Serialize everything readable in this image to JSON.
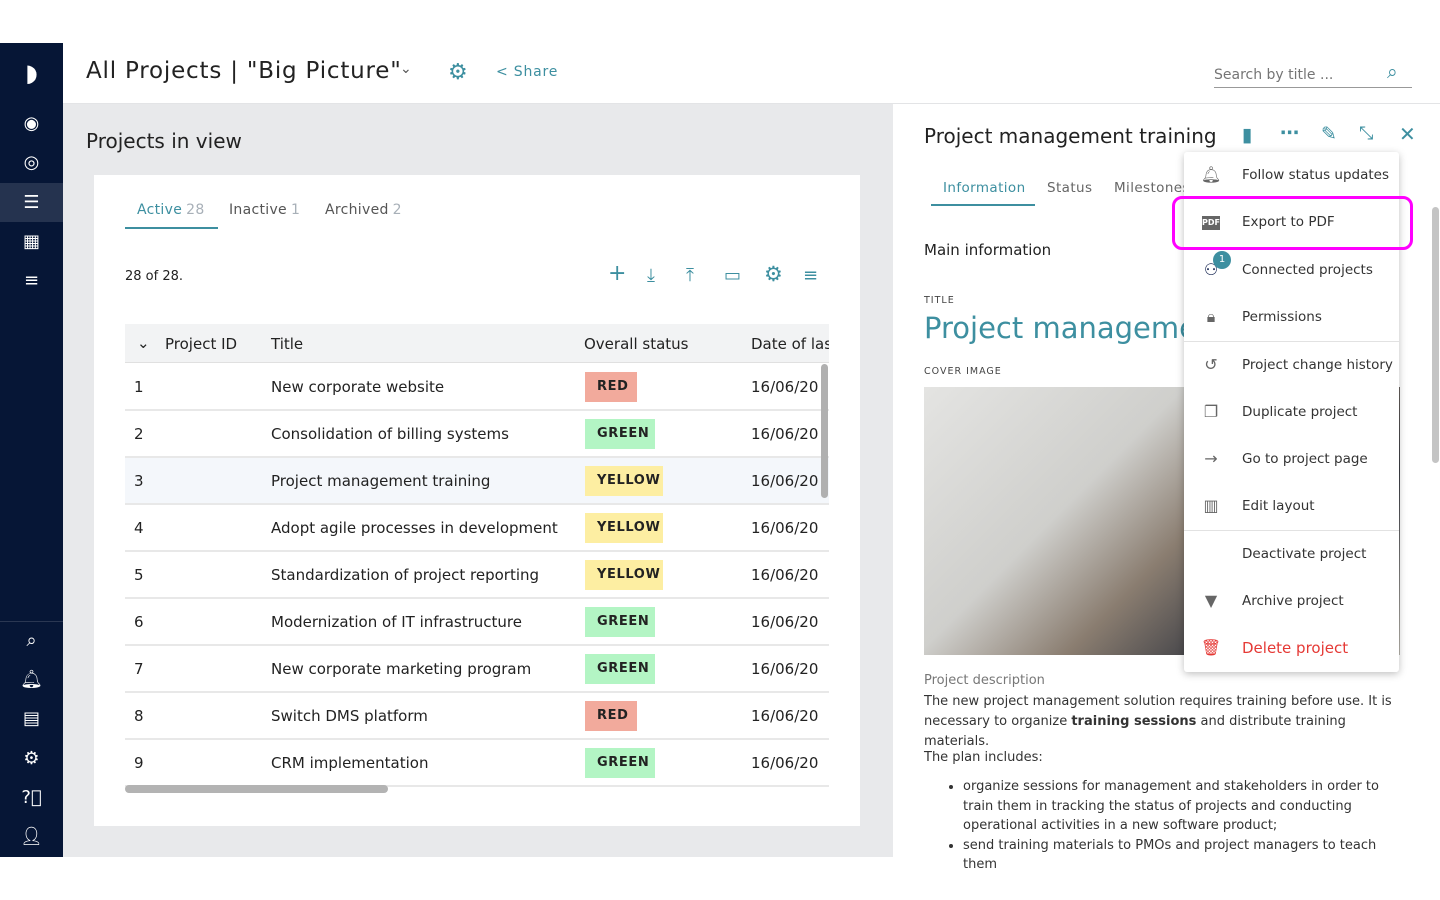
{
  "header": {
    "title": "All Projects | \"Big Picture\"",
    "share": "Share",
    "search_placeholder": "Search by title ..."
  },
  "section_title": "Projects in view",
  "tabs": [
    {
      "label": "Active",
      "count": "28"
    },
    {
      "label": "Inactive",
      "count": "1"
    },
    {
      "label": "Archived",
      "count": "2"
    }
  ],
  "count_text": "28 of 28.",
  "table": {
    "columns": [
      "Project ID",
      "Title",
      "Overall status",
      "Date of last"
    ],
    "rows": [
      {
        "id": "1",
        "title": "New corporate website",
        "status": "RED",
        "date": "16/06/20"
      },
      {
        "id": "2",
        "title": "Consolidation of billing systems",
        "status": "GREEN",
        "date": "16/06/20"
      },
      {
        "id": "3",
        "title": "Project management training",
        "status": "YELLOW",
        "date": "16/06/20"
      },
      {
        "id": "4",
        "title": "Adopt agile processes in development",
        "status": "YELLOW",
        "date": "16/06/20"
      },
      {
        "id": "5",
        "title": "Standardization of project reporting",
        "status": "YELLOW",
        "date": "16/06/20"
      },
      {
        "id": "6",
        "title": "Modernization of IT infrastructure",
        "status": "GREEN",
        "date": "16/06/20"
      },
      {
        "id": "7",
        "title": "New corporate marketing program",
        "status": "GREEN",
        "date": "16/06/20"
      },
      {
        "id": "8",
        "title": "Switch DMS platform",
        "status": "RED",
        "date": "16/06/20"
      },
      {
        "id": "9",
        "title": "CRM implementation",
        "status": "GREEN",
        "date": "16/06/20"
      }
    ]
  },
  "status_colors": {
    "RED": "#f2aa9c",
    "GREEN": "#b3f5c4",
    "YELLOW": "#fdeea2"
  },
  "panel": {
    "title": "Project management training",
    "tabs": [
      "Information",
      "Status",
      "Milestones"
    ],
    "main_info": "Main information",
    "title_label": "TITLE",
    "title_value": "Project management training",
    "cover_label": "COVER IMAGE",
    "desc_label": "Project description",
    "desc_1": "The new project management solution requires training before use. It is necessary to organize ",
    "desc_bold": "training sessions",
    "desc_2": " and distribute training materials.",
    "plan": "The plan includes:",
    "bullets": [
      "organize sessions for management and stakeholders in order to train them in tracking the status of projects and conducting operational activities in a new software product;",
      "send training materials to PMOs and project managers to teach them"
    ]
  },
  "menu": {
    "items": [
      "Follow status updates",
      "Export to PDF",
      "Connected projects",
      "Permissions",
      "Project change history",
      "Duplicate project",
      "Go to project page",
      "Edit layout",
      "Deactivate project",
      "Archive project",
      "Delete project"
    ],
    "connected_badge": "1",
    "pdf_glyph": "PDF"
  },
  "colors": {
    "accent": "#3d8fa0",
    "sidebar": "#061636",
    "highlight": "#ff00ff",
    "danger": "#e53935"
  }
}
